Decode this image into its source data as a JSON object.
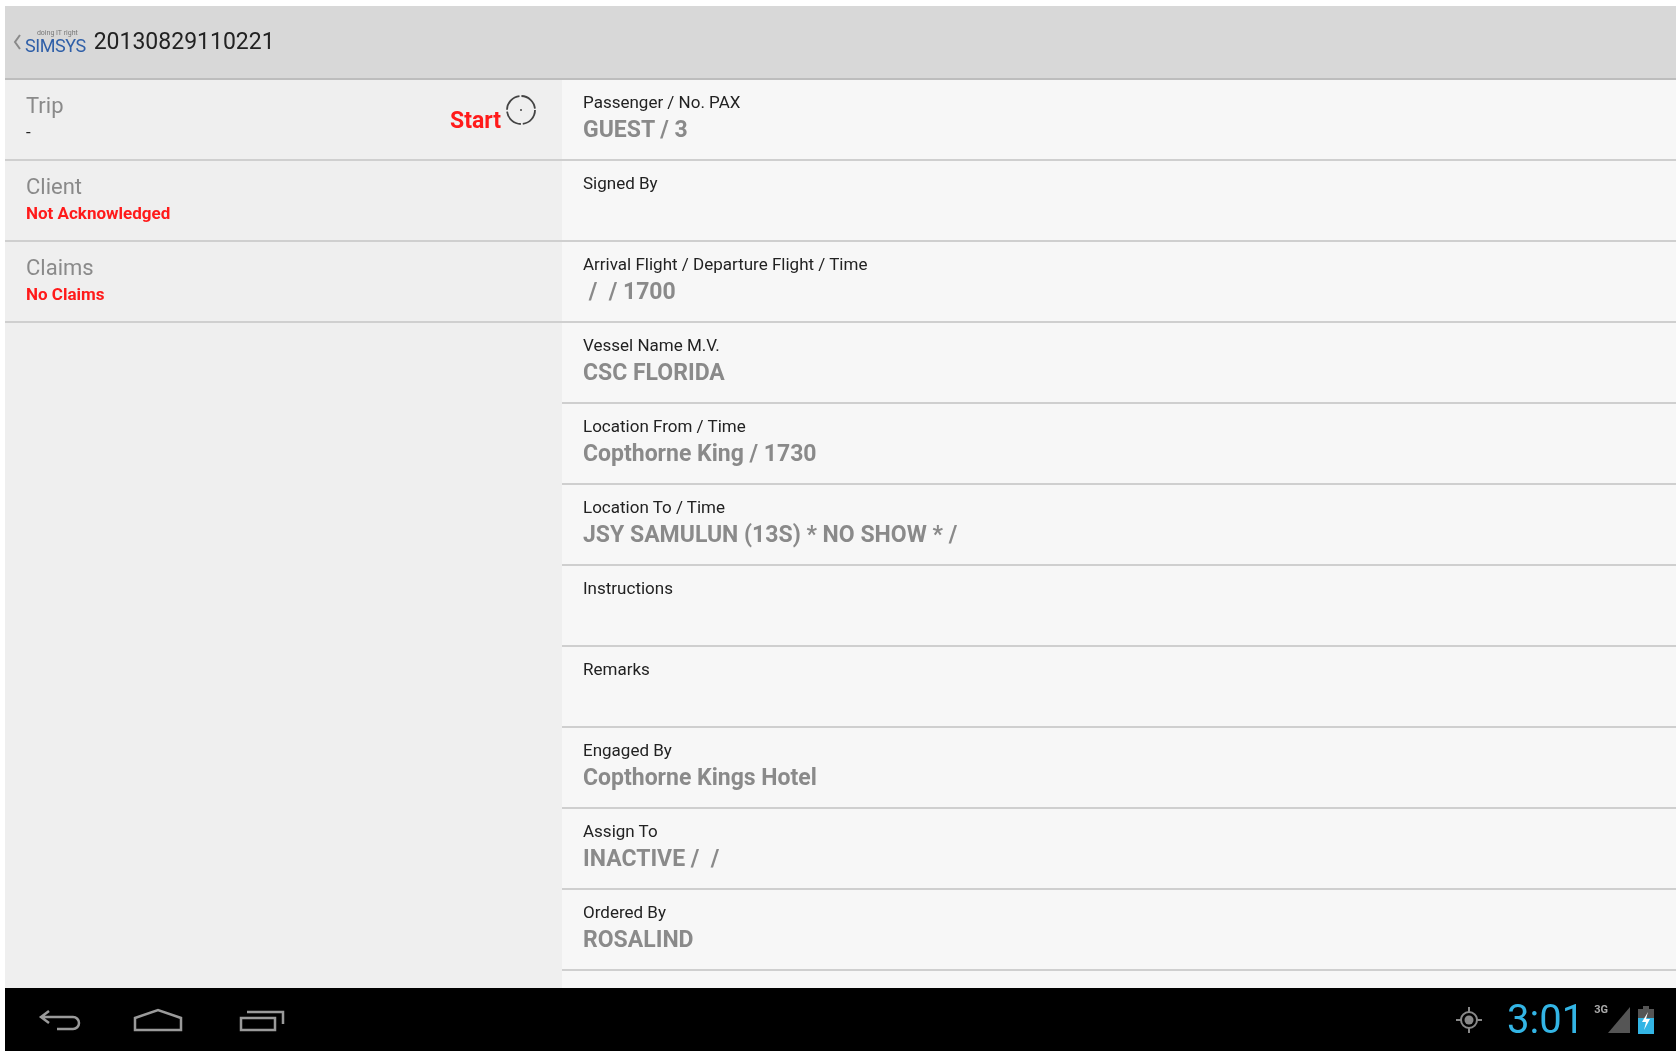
{
  "action_bar": {
    "logo": {
      "tagline": "doing IT right",
      "name": "SIMSYS"
    },
    "title": "20130829110221"
  },
  "summary": [
    {
      "title": "Trip",
      "value": "-",
      "alert": false,
      "action": {
        "label": "Start"
      }
    },
    {
      "title": "Client",
      "value": "Not Acknowledged",
      "alert": true
    },
    {
      "title": "Claims",
      "value": "No Claims",
      "alert": true
    }
  ],
  "details": [
    {
      "label": "Passenger / No. PAX",
      "value": "GUEST / 3"
    },
    {
      "label": "Signed By"
    },
    {
      "label": "Arrival Flight / Departure Flight / Time",
      "value": " /  / 1700"
    },
    {
      "label": "Vessel Name M.V.",
      "value": "CSC FLORIDA"
    },
    {
      "label": "Location From / Time",
      "value": "Copthorne King / 1730"
    },
    {
      "label": "Location To / Time",
      "value": "JSY SAMULUN (13S) * NO SHOW * /"
    },
    {
      "label": "Instructions"
    },
    {
      "label": "Remarks"
    },
    {
      "label": "Engaged By",
      "value": "Copthorne Kings Hotel"
    },
    {
      "label": "Assign To",
      "value": "INACTIVE /  /"
    },
    {
      "label": "Ordered By",
      "value": "ROSALIND"
    }
  ],
  "status_bar": {
    "clock": "3:01",
    "network": "3G"
  }
}
